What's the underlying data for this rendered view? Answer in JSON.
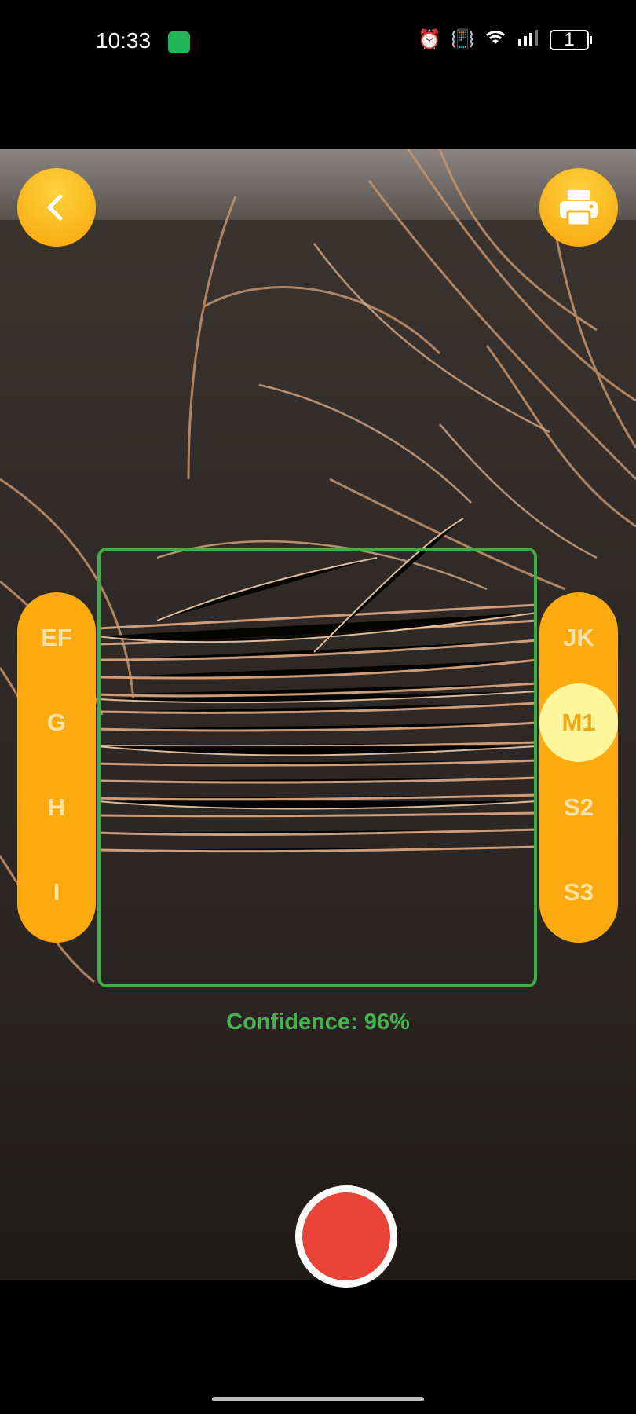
{
  "status_bar": {
    "time": "10:33",
    "battery_level": "1",
    "icons": [
      "app-badge-icon",
      "alarm-icon",
      "vibrate-icon",
      "wifi-icon",
      "signal-icon",
      "battery-icon"
    ]
  },
  "toolbar": {
    "back_icon": "chevron-left-icon",
    "print_icon": "printer-icon"
  },
  "left_grades": [
    "EF",
    "G",
    "H",
    "I"
  ],
  "right_grades": [
    "JK",
    "M1",
    "S2",
    "S3"
  ],
  "selected_grade": "M1",
  "result": {
    "confidence_text": "Confidence: 96%"
  },
  "colors": {
    "accent": "#fcaa0f",
    "selected_grade_bg": "#fff59b",
    "detect_box": "#3fae49",
    "shutter": "#ea4236"
  }
}
